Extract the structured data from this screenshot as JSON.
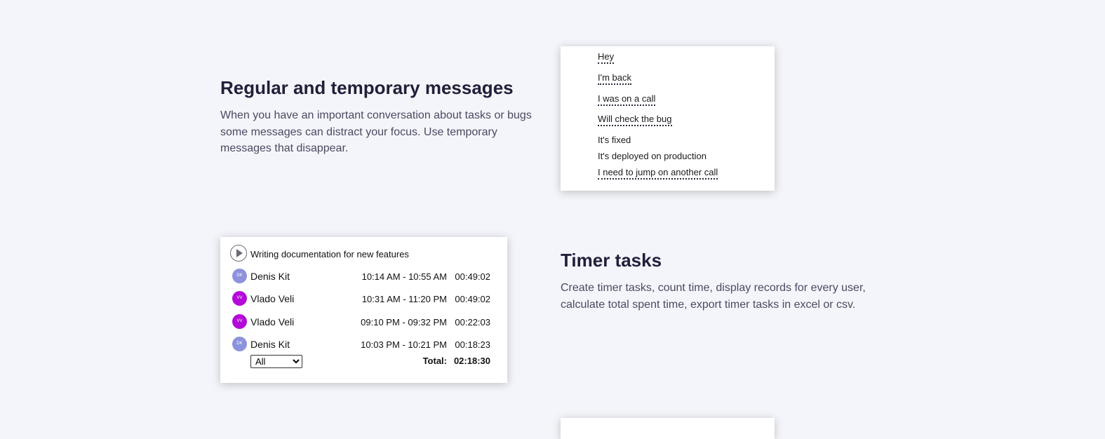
{
  "section1": {
    "title": "Regular and temporary messages",
    "description": "When you have an important conversation about tasks or bugs some messages can distract your focus. Use temporary messages that disappear."
  },
  "messages": [
    {
      "text": "Hey",
      "temporary": true
    },
    {
      "text": "I'm back",
      "temporary": true
    },
    {
      "text": "I was on a call",
      "temporary": true
    },
    {
      "text": "Will check the bug",
      "temporary": true
    },
    {
      "text": "It's fixed",
      "temporary": false
    },
    {
      "text": "It's deployed on production",
      "temporary": false
    },
    {
      "text": "I need to jump on another call",
      "temporary": true
    }
  ],
  "section2": {
    "title": "Timer tasks",
    "description": "Create timer tasks, count time, display records for every user, calculate total spent time, export timer tasks in excel or csv."
  },
  "timer": {
    "play_icon": "play-icon",
    "task_title": "Writing documentation for new features",
    "records": [
      {
        "initials": "DK",
        "name": "Denis Kit",
        "range": "10:14 AM - 10:55 AM",
        "duration": "00:49:02",
        "color": "#8d92dc"
      },
      {
        "initials": "VV",
        "name": "Vlado Veli",
        "range": "10:31 AM - 11:20 PM",
        "duration": "00:49:02",
        "color": "#b30ad8"
      },
      {
        "initials": "VV",
        "name": "Vlado Veli",
        "range": "09:10 PM - 09:32 PM",
        "duration": "00:22:03",
        "color": "#b30ad8"
      },
      {
        "initials": "DK",
        "name": "Denis Kit",
        "range": "10:03 PM - 10:21 PM",
        "duration": "00:18:23",
        "color": "#8d92dc"
      }
    ],
    "filter": {
      "selected": "All",
      "options": [
        "All"
      ]
    },
    "total_label": "Total:",
    "total_value": "02:18:30"
  }
}
